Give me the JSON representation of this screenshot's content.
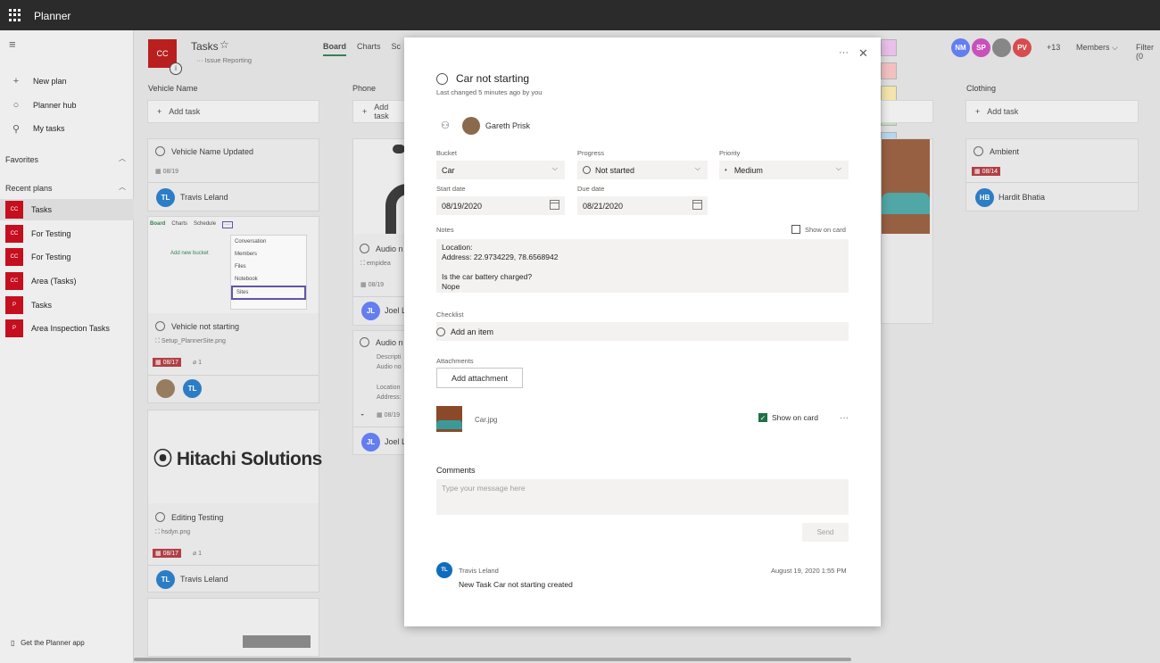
{
  "app": {
    "name": "Planner"
  },
  "sidebar": {
    "new_plan": "New plan",
    "planner_hub": "Planner hub",
    "my_tasks": "My tasks",
    "favorites": "Favorites",
    "recent_plans": "Recent plans",
    "plans": [
      {
        "abbr": "CC",
        "name": "Tasks",
        "color": "#c50f1f"
      },
      {
        "abbr": "CC",
        "name": "For Testing",
        "color": "#c50f1f"
      },
      {
        "abbr": "CC",
        "name": "For Testing",
        "color": "#c50f1f"
      },
      {
        "abbr": "CC",
        "name": "Area (Tasks)",
        "color": "#c50f1f"
      },
      {
        "abbr": "P",
        "name": "Tasks",
        "color": "#c50f1f"
      },
      {
        "abbr": "P",
        "name": "Area Inspection Tasks",
        "color": "#c50f1f"
      }
    ],
    "get_app": "Get the Planner app"
  },
  "plan": {
    "abbr": "CC",
    "title": "Tasks",
    "star": "☆",
    "subtitle": "··· Issue Reporting",
    "info": "i",
    "tabs": [
      "Board",
      "Charts",
      "Sc"
    ]
  },
  "header": {
    "avatars": [
      {
        "initials": "NM",
        "color": "#4f6bed"
      },
      {
        "initials": "SP",
        "color": "#c239b3"
      },
      {
        "initials": "",
        "color": "#777777"
      },
      {
        "initials": "PV",
        "color": "#d13438"
      }
    ],
    "more_count": "+13",
    "members": "Members",
    "filter": "Filter (0"
  },
  "board": {
    "add_task": "Add task",
    "buckets": [
      "Vehicle Name",
      "Phone",
      "Clothing"
    ],
    "cards": {
      "c1": {
        "title": "Vehicle Name Updated",
        "due": "08/19",
        "assignee": "Travis Leland",
        "initials": "TL"
      },
      "c2": {
        "tabs": [
          "Board",
          "Charts",
          "Schedule",
          "···"
        ],
        "menu": [
          "Conversation",
          "Members",
          "Files",
          "Notebook",
          "Sites"
        ],
        "add_bucket": "Add new bucket",
        "title": "Vehicle not starting",
        "file": "Setup_PlannerSite.png",
        "due": "08/17",
        "attach": "1",
        "initials": "TL"
      },
      "c3": {
        "logo": "Hitachi Solutions",
        "title": "Editing Testing",
        "file": "hsdyn.png",
        "due": "08/17",
        "attach": "1",
        "assignee": "Travis Leland",
        "initials": "TL"
      },
      "p1": {
        "title": "Audio n",
        "file": "empidea",
        "due": "08/19",
        "assignee": "Joel L",
        "initials": "JL"
      },
      "p2": {
        "title": "Audio n",
        "desc": "Descripti",
        "desc2": "Audio no",
        "loc": "Location",
        "addr": "Address:",
        "due": "08/19",
        "assignee": "Joel L",
        "initials": "JL"
      },
      "k1": {
        "title": "Ambient",
        "due": "08/14",
        "assignee": "Hardit Bhatia",
        "initials": "HB"
      }
    }
  },
  "task": {
    "title": "Car not starting",
    "last_changed": "Last changed 5 minutes ago by you",
    "assignee": "Gareth Prisk",
    "bucket_label": "Bucket",
    "bucket": "Car",
    "progress_label": "Progress",
    "progress": "Not started",
    "priority_label": "Priority",
    "priority": "Medium",
    "start_label": "Start date",
    "start": "08/19/2020",
    "due_label": "Due date",
    "due": "08/21/2020",
    "notes_label": "Notes",
    "show_on_card": "Show on card",
    "notes": [
      "Location:",
      "Address: 22.9734229, 78.6568942",
      "",
      "Is the car battery charged?",
      "Nope"
    ],
    "checklist_label": "Checklist",
    "add_item": "Add an item",
    "attachments_label": "Attachments",
    "add_attachment": "Add attachment",
    "attachment_name": "Car.jpg",
    "attachment_show": "Show on card",
    "comments_label": "Comments",
    "comment_placeholder": "Type your message here",
    "send": "Send",
    "comment": {
      "initials": "TL",
      "author": "Travis Leland",
      "date": "August 19, 2020 1:55 PM",
      "text": "New Task Car not starting created"
    }
  }
}
